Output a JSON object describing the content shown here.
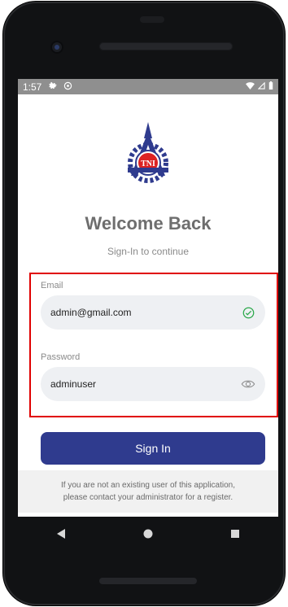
{
  "status_bar": {
    "time": "1:57"
  },
  "app": {
    "logo_text": "TNI",
    "title": "Welcome Back",
    "subtitle": "Sign-In to continue"
  },
  "form": {
    "email_label": "Email",
    "email_value": "admin@gmail.com",
    "password_label": "Password",
    "password_value": "adminuser"
  },
  "actions": {
    "signin_label": "Sign In"
  },
  "notice": {
    "line1": "If you are not an existing user of this application,",
    "line2": "please contact your administrator for a register."
  },
  "icons": {
    "status_left": [
      "gear-icon",
      "at-icon"
    ],
    "status_right": [
      "wifi-icon",
      "signal-icon",
      "battery-icon"
    ],
    "email_status": "check-circle-icon",
    "password_toggle": "eye-icon",
    "nav": [
      "back-icon",
      "home-icon",
      "recents-icon"
    ]
  },
  "colors": {
    "primary": "#2f3b8e",
    "highlight_border": "#e00000",
    "check_green": "#2aa84a",
    "status_bar": "#8f8f8f"
  }
}
